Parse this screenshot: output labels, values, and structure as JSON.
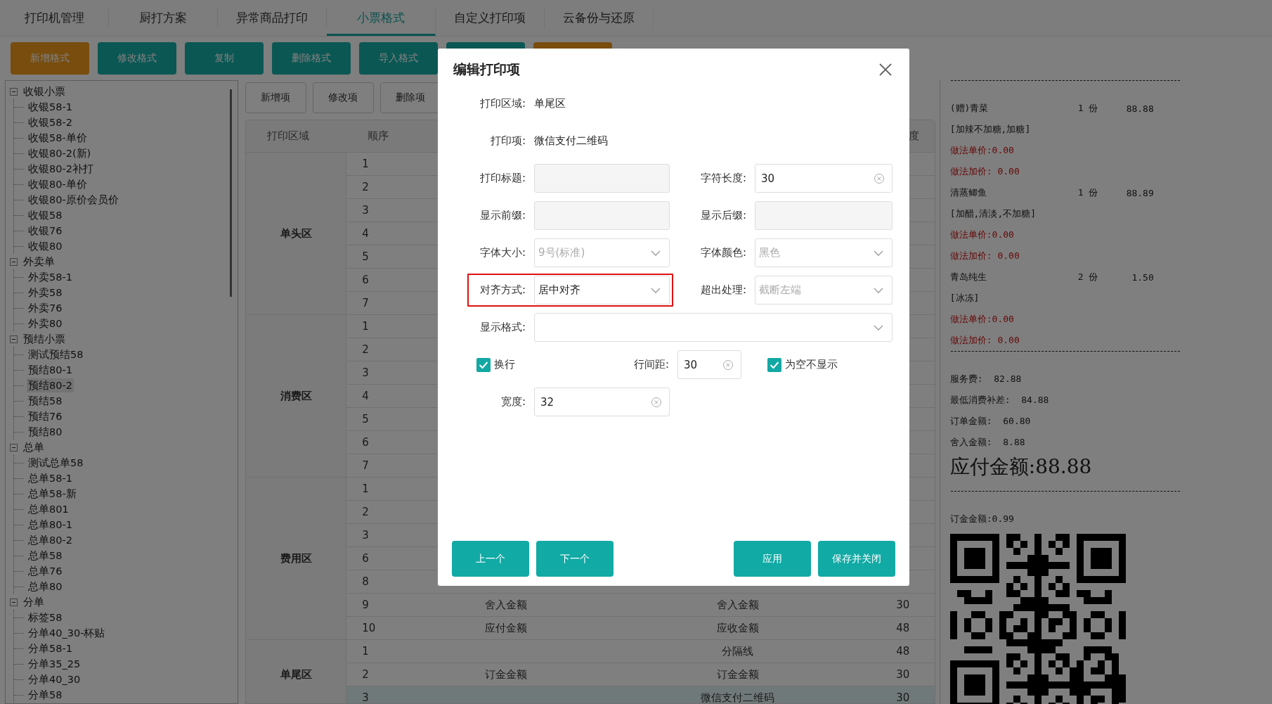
{
  "tabs": [
    {
      "label": "打印机管理",
      "selected": false
    },
    {
      "label": "厨打方案",
      "selected": false
    },
    {
      "label": "异常商品打印",
      "selected": false
    },
    {
      "label": "小票格式",
      "selected": true
    },
    {
      "label": "自定义打印项",
      "selected": false
    },
    {
      "label": "云备份与还原",
      "selected": false
    }
  ],
  "toolbar": [
    {
      "kind": "warning",
      "label": "新增格式"
    },
    {
      "kind": "primary",
      "label": "修改格式"
    },
    {
      "kind": "primary",
      "label": "复制"
    },
    {
      "kind": "primary",
      "label": "删除格式"
    },
    {
      "kind": "primary",
      "label": "导入格式"
    },
    {
      "kind": "primary"
    },
    {
      "kind": "warning"
    }
  ],
  "tree": [
    {
      "label": "收银小票",
      "expanded": true,
      "children": [
        {
          "label": "收银58-1",
          "selected": false
        },
        {
          "label": "收银58-2",
          "selected": false
        },
        {
          "label": "收银58-单价",
          "selected": false
        },
        {
          "label": "收银80-2(新)",
          "selected": false
        },
        {
          "label": "收银80-2补打",
          "selected": false
        },
        {
          "label": "收银80-单价",
          "selected": false
        },
        {
          "label": "收银80-原价会员价",
          "selected": false
        },
        {
          "label": "收银58",
          "selected": false
        },
        {
          "label": "收银76",
          "selected": false
        },
        {
          "label": "收银80",
          "selected": false
        }
      ]
    },
    {
      "label": "外卖单",
      "expanded": true,
      "children": [
        {
          "label": "外卖58-1",
          "selected": false
        },
        {
          "label": "外卖58",
          "selected": false
        },
        {
          "label": "外卖76",
          "selected": false
        },
        {
          "label": "外卖80",
          "selected": false
        }
      ]
    },
    {
      "label": "预结小票",
      "expanded": true,
      "children": [
        {
          "label": "测试预结58",
          "selected": false
        },
        {
          "label": "预结80-1",
          "selected": false
        },
        {
          "label": "预结80-2",
          "selected": true
        },
        {
          "label": "预结58",
          "selected": false
        },
        {
          "label": "预结76",
          "selected": false
        },
        {
          "label": "预结80",
          "selected": false
        }
      ]
    },
    {
      "label": "总单",
      "expanded": true,
      "children": [
        {
          "label": "测试总单58",
          "selected": false
        },
        {
          "label": "总单58-1",
          "selected": false
        },
        {
          "label": "总单58-新",
          "selected": false
        },
        {
          "label": "总单801",
          "selected": false
        },
        {
          "label": "总单80-1",
          "selected": false
        },
        {
          "label": "总单80-2",
          "selected": false
        },
        {
          "label": "总单58",
          "selected": false
        },
        {
          "label": "总单76",
          "selected": false
        },
        {
          "label": "总单80",
          "selected": false
        }
      ]
    },
    {
      "label": "分单",
      "expanded": true,
      "children": [
        {
          "label": "标签58",
          "selected": false
        },
        {
          "label": "分单40_30-杯贴",
          "selected": false
        },
        {
          "label": "分单58-1",
          "selected": false
        },
        {
          "label": "分单35_25",
          "selected": false
        },
        {
          "label": "分单40_30",
          "selected": false
        },
        {
          "label": "分单58",
          "selected": false
        }
      ]
    }
  ],
  "item_toolbar": [
    "新增项",
    "修改项",
    "删除项"
  ],
  "table": {
    "columns": [
      "打印区域",
      "顺序"
    ],
    "column_5": "度",
    "groups": [
      {
        "area": "单头区",
        "rows": [
          {
            "order": "1",
            "selected": false
          },
          {
            "order": "2",
            "selected": false
          },
          {
            "order": "3",
            "selected": false
          },
          {
            "order": "4",
            "selected": false
          },
          {
            "order": "5",
            "selected": false
          },
          {
            "order": "6",
            "selected": false
          },
          {
            "order": "7",
            "selected": false
          }
        ]
      },
      {
        "area": "消费区",
        "rows": [
          {
            "order": "1",
            "selected": false
          },
          {
            "order": "2",
            "selected": false
          },
          {
            "order": "3",
            "selected": false
          },
          {
            "order": "4",
            "selected": false
          },
          {
            "order": "5",
            "selected": false
          },
          {
            "order": "6",
            "selected": false
          },
          {
            "order": "7",
            "selected": false
          }
        ]
      },
      {
        "area": "费用区",
        "rows": [
          {
            "order": "1",
            "selected": false
          },
          {
            "order": "2",
            "selected": false
          },
          {
            "order": "3",
            "selected": false
          },
          {
            "order": "6",
            "selected": false
          },
          {
            "order": "8",
            "selected": false
          },
          {
            "order": "9",
            "column_3": "舍入金额",
            "column_4": "舍入金额",
            "column_5": "30",
            "selected": false
          },
          {
            "order": "10",
            "column_3": "应付金额",
            "column_4": "应收金额",
            "column_5": "48",
            "selected": false
          }
        ]
      },
      {
        "area": "单尾区",
        "rows": [
          {
            "order": "1",
            "column_4": "分隔线",
            "column_5": "48",
            "selected": false
          },
          {
            "order": "2",
            "column_3": "订金金额",
            "column_4": "订金金额",
            "column_5": "30",
            "selected": false
          },
          {
            "order": "3",
            "column_4": "微信支付二维码",
            "column_5": "30",
            "selected": true
          }
        ]
      }
    ]
  },
  "receipt": [
    {
      "kind": "divider"
    },
    {
      "kind": "item",
      "name": "(赠)青菜",
      "qty": "1 份",
      "price": "88.88"
    },
    {
      "kind": "note",
      "text": "[加辣不加糖,加糖]"
    },
    {
      "kind": "fee",
      "text": "做法单价:0.00"
    },
    {
      "kind": "fee",
      "text": "做法加价: 0.00"
    },
    {
      "kind": "item",
      "name": "清蒸鲫鱼",
      "qty": "1 份",
      "price": "88.89"
    },
    {
      "kind": "note",
      "text": "[加醋,清淡,不加糖]"
    },
    {
      "kind": "fee",
      "text": "做法单价:0.00"
    },
    {
      "kind": "fee",
      "text": "做法加价: 0.00"
    },
    {
      "kind": "item",
      "name": "青岛纯生",
      "qty": "2 份",
      "price": "1.50"
    },
    {
      "kind": "note",
      "text": "[冰冻]"
    },
    {
      "kind": "fee",
      "text": "做法单价:0.00"
    },
    {
      "kind": "fee",
      "text": "做法加价: 0.00"
    },
    {
      "kind": "divider"
    },
    {
      "kind": "summary",
      "text": "服务费:  82.88"
    },
    {
      "kind": "summary",
      "text": "最低消费补差:  84.88"
    },
    {
      "kind": "summary",
      "text": "订单金额:  60.80"
    },
    {
      "kind": "summary",
      "text": "舍入金额:  8.88"
    },
    {
      "kind": "total",
      "text": "应付金额:88.88"
    },
    {
      "kind": "divider"
    },
    {
      "kind": "summary",
      "text": "订金金额:0.99"
    },
    {
      "kind": "qr"
    }
  ],
  "dialog": {
    "title": "编辑打印项",
    "rows": [
      [
        {
          "kind": "static",
          "label": "打印区域:",
          "value": "单尾区"
        }
      ],
      [
        {
          "kind": "static",
          "label": "打印项:",
          "value": "微信支付二维码"
        }
      ],
      [
        {
          "kind": "input",
          "label": "打印标题:"
        },
        {
          "kind": "input",
          "label": "字符长度:",
          "value": "30"
        }
      ],
      [
        {
          "kind": "input",
          "label": "显示前缀:"
        },
        {
          "kind": "input",
          "label": "显示后缀:"
        }
      ],
      [
        {
          "kind": "select",
          "label": "字体大小:",
          "placeholder": "9号(标准)"
        },
        {
          "kind": "select",
          "label": "字体颜色:",
          "placeholder": "黑色"
        }
      ],
      [
        {
          "kind": "select",
          "label": "对齐方式:",
          "value": "居中对齐",
          "highlighted": true
        },
        {
          "kind": "select",
          "label": "超出处理:",
          "placeholder": "截断左端"
        }
      ],
      [
        {
          "kind": "wide_select",
          "label": "显示格式:"
        }
      ],
      [
        {
          "kind": "checkbox",
          "label": "换行",
          "checked": true
        },
        {
          "kind": "input",
          "label": "行间距:",
          "value": "30"
        },
        {
          "kind": "checkbox",
          "label": "为空不显示",
          "checked": true
        }
      ],
      [
        {
          "kind": "input",
          "label": "宽度:",
          "value": "32"
        }
      ]
    ],
    "buttons_left": [
      "上一个",
      "下一个"
    ],
    "buttons_right": [
      "应用",
      "保存并关闭"
    ]
  }
}
